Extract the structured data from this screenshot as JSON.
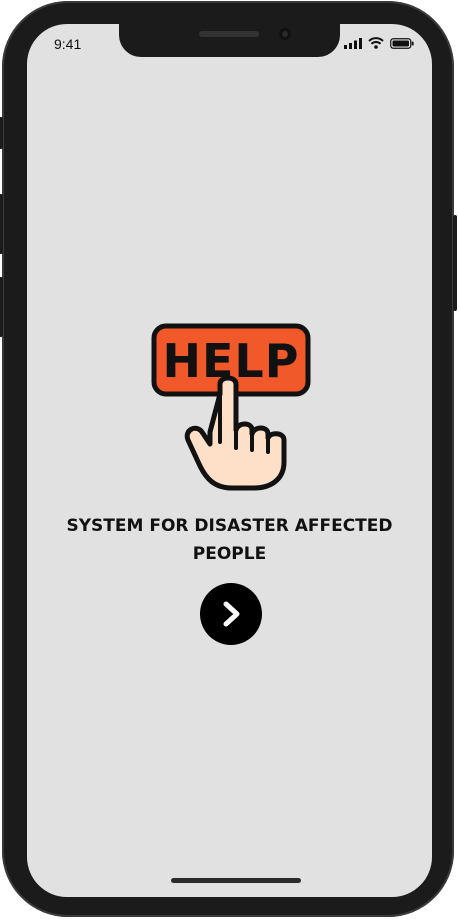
{
  "status_bar": {
    "time": "9:41",
    "signal_icon": "cellular-signal-icon",
    "wifi_icon": "wifi-icon",
    "battery_icon": "battery-icon"
  },
  "hero": {
    "icon": "help-button-hand-icon",
    "button_text": "HELP",
    "colors": {
      "button_fill": "#f1592a",
      "outline": "#111111",
      "skin": "#fde0c7"
    }
  },
  "main": {
    "title_line1": "SYSTEM FOR DISASTER AFFECTED",
    "title_line2": "PEOPLE"
  },
  "next_button": {
    "icon": "chevron-right-icon",
    "color": "#000000"
  }
}
